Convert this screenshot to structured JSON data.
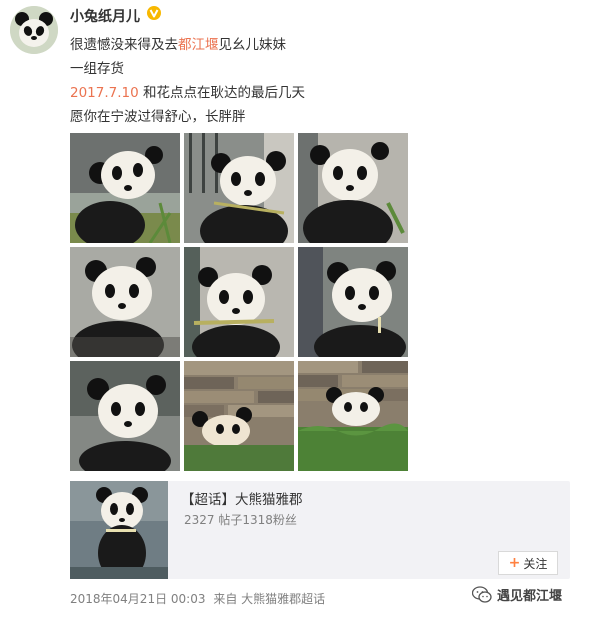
{
  "post": {
    "username": "小兔纸月儿",
    "verified_icon": "gold-v-badge",
    "lines": {
      "line1_before": "很遗憾没来得及去",
      "line1_link": "都江堰",
      "line1_after": "见幺儿妹妹",
      "line2": "一组存货",
      "line3_date": "2017.7.10",
      "line3_after": " 和花点点在耿达的最后几天",
      "line4": "愿你在宁波过得舒心，长胖胖"
    },
    "photo_count": 9,
    "footer": {
      "timestamp": "2018年04月21日 00:03",
      "source_prefix": "来自",
      "source_name": "大熊猫雅郡超话"
    }
  },
  "topic_card": {
    "title": "【超话】大熊猫雅郡",
    "stats": "2327 帖子1318粉丝",
    "follow_label": "关注",
    "follow_icon": "plus-icon"
  },
  "watermark": {
    "icon": "wechat-icon",
    "text": "遇见都江堰"
  },
  "colors": {
    "link": "#eb7350",
    "text": "#333333",
    "muted": "#808080",
    "card_bg": "#f2f2f5"
  }
}
